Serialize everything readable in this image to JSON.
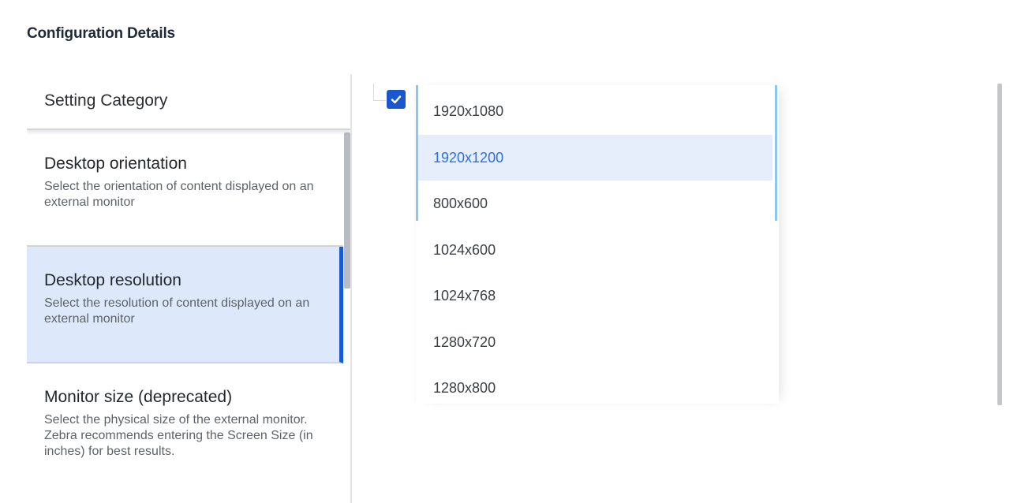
{
  "page": {
    "title": "Configuration Details"
  },
  "categories": {
    "header": "Setting Category",
    "items": [
      {
        "title": "Desktop orientation",
        "description": "Select the orientation of content displayed on an external monitor",
        "selected": false
      },
      {
        "title": "Desktop resolution",
        "description": "Select the resolution of content displayed on an external monitor",
        "selected": true
      },
      {
        "title": "Monitor size (deprecated)",
        "description": "Select the physical size of the external monitor. Zebra recommends entering the Screen Size (in inches) for best results.",
        "selected": false
      }
    ]
  },
  "resolution_option": {
    "checked": true,
    "options": [
      "1920x1080",
      "1920x1200",
      "800x600",
      "1024x600",
      "1024x768",
      "1280x720",
      "1280x800"
    ],
    "highlighted": "1920x1200"
  },
  "colors": {
    "accent": "#1a56cc",
    "selected_bg": "#dde8fb",
    "highlight_text": "#2f6ee0",
    "dropdown_accent": "#8dc6ee"
  }
}
